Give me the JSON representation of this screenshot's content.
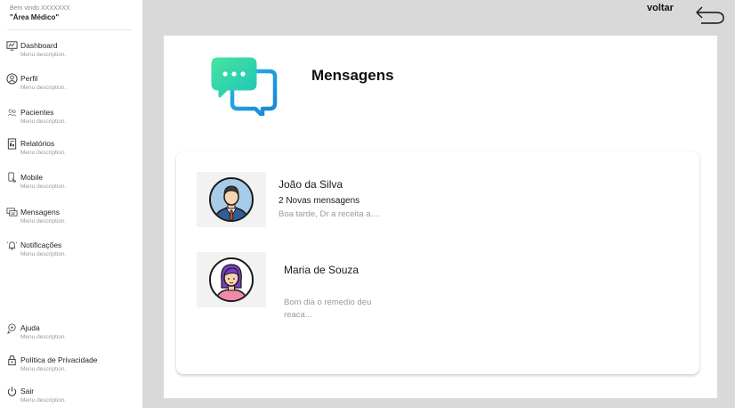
{
  "sidebar": {
    "welcome": "Bem vindo XXXXXXX",
    "area": "\"Área Médico\"",
    "items": [
      {
        "label": "Dashboard",
        "desc": "Menu description.",
        "icon": "dashboard-icon"
      },
      {
        "label": "Perfil",
        "desc": "Menu description.",
        "icon": "user-icon"
      },
      {
        "label": "Pacientes",
        "desc": "Menu description.",
        "icon": "people-icon"
      },
      {
        "label": "Relatórios",
        "desc": "Menu description.",
        "icon": "report-icon"
      },
      {
        "label": "Mobile",
        "desc": "Menu description.",
        "icon": "mobile-icon"
      },
      {
        "label": "Mensagens",
        "desc": "Menu description.",
        "icon": "messages-icon"
      },
      {
        "label": "Notificações",
        "desc": "Menu description.",
        "icon": "bell-icon"
      },
      {
        "label": "Ajuda",
        "desc": "Menu description.",
        "icon": "help-icon"
      },
      {
        "label": "Política de Privacidade",
        "desc": "Menu description.",
        "icon": "lock-icon"
      },
      {
        "label": "Sair",
        "desc": "Menu description.",
        "icon": "power-icon"
      }
    ]
  },
  "header": {
    "back_label": "voltar",
    "back_icon": "back-arrow-icon"
  },
  "main": {
    "title": "Mensagens",
    "title_icon": "chat-bubbles-icon",
    "conversations": [
      {
        "name": "João da Silva",
        "new_messages": "2 Novas mensagens",
        "preview": "Boa tarde, Dr a receita a....",
        "avatar": "male-doctor-avatar"
      },
      {
        "name": "Maria de Souza",
        "new_messages": "",
        "preview": "Bom dia o remedio deu reaca...",
        "avatar": "female-avatar"
      }
    ]
  },
  "colors": {
    "background": "#d9d9d9",
    "chat_icon_green": "#3ddc97",
    "chat_icon_blue": "#1f9ce0"
  }
}
